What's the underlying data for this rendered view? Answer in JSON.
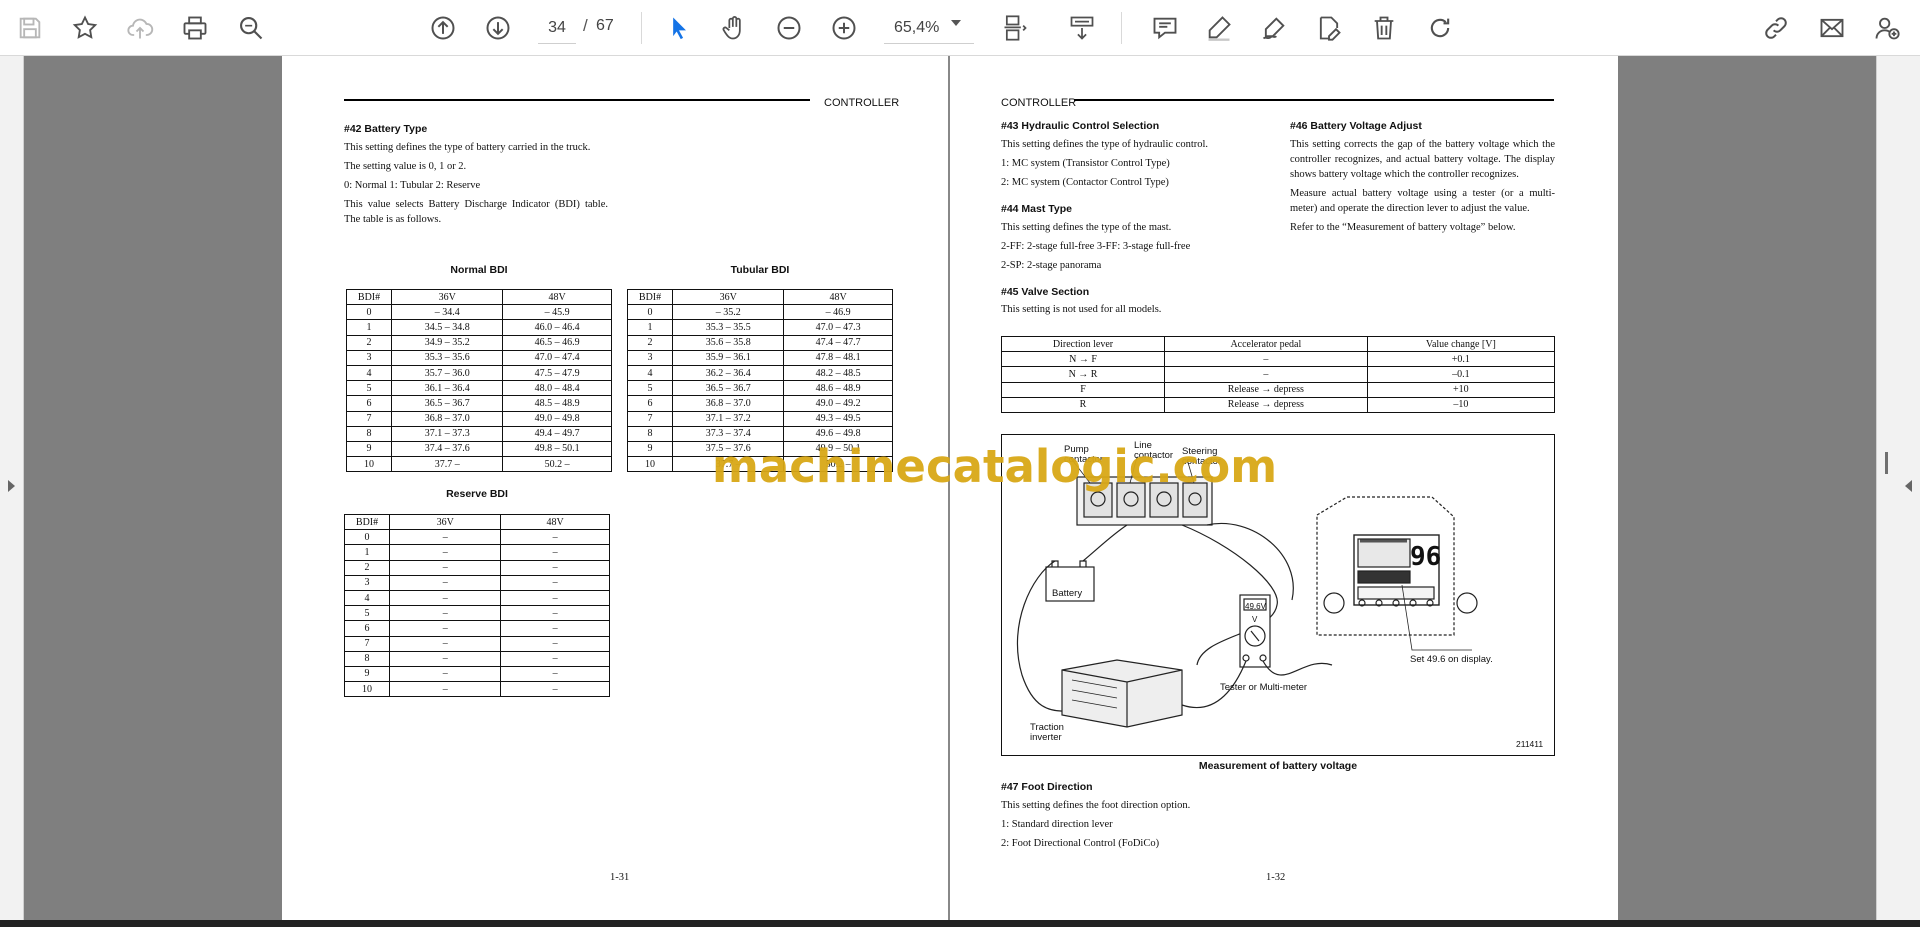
{
  "toolbar": {
    "current_page": "34",
    "page_separator": "/",
    "total_pages": "67",
    "zoom": "65,4%",
    "icons": [
      "save-icon",
      "bookmark-star-icon",
      "cloud-upload-icon",
      "print-icon",
      "find-text-icon",
      "page-up-icon",
      "page-down-icon",
      "select-cursor-icon",
      "hand-tool-icon",
      "zoom-out-icon",
      "zoom-in-icon",
      "page-fit-icon",
      "scroll-mode-icon",
      "comment-icon",
      "highlight-pen-icon",
      "draw-sign-icon",
      "fill-sign-icon",
      "delete-icon",
      "rotate-icon",
      "share-link-icon",
      "email-icon",
      "add-user-icon"
    ]
  },
  "colors": {
    "accent": "#1473e6",
    "watermark": "#d9a817",
    "viewer_bg": "#7f7f7f"
  },
  "watermark": "machinecatalogic.com",
  "left_page": {
    "header": "CONTROLLER",
    "section_title": "#42 Battery Type",
    "paragraphs": [
      "This setting defines the type of battery carried in the truck.",
      "The setting value is 0, 1 or 2.",
      "0: Normal  1: Tubular  2: Reserve",
      "This value selects Battery Discharge Indicator (BDI) table. The table is as follows."
    ],
    "normal_bdi": {
      "title": "Normal BDI",
      "headers": [
        "BDI#",
        "36V",
        "48V"
      ],
      "rows": [
        [
          "0",
          "– 34.4",
          "– 45.9"
        ],
        [
          "1",
          "34.5 – 34.8",
          "46.0 – 46.4"
        ],
        [
          "2",
          "34.9 – 35.2",
          "46.5 – 46.9"
        ],
        [
          "3",
          "35.3 – 35.6",
          "47.0 – 47.4"
        ],
        [
          "4",
          "35.7 – 36.0",
          "47.5 – 47.9"
        ],
        [
          "5",
          "36.1 – 36.4",
          "48.0 – 48.4"
        ],
        [
          "6",
          "36.5 – 36.7",
          "48.5 – 48.9"
        ],
        [
          "7",
          "36.8 – 37.0",
          "49.0 – 49.8"
        ],
        [
          "8",
          "37.1 – 37.3",
          "49.4 – 49.7"
        ],
        [
          "9",
          "37.4 – 37.6",
          "49.8 – 50.1"
        ],
        [
          "10",
          "37.7 –",
          "50.2 –"
        ]
      ]
    },
    "tubular_bdi": {
      "title": "Tubular BDI",
      "headers": [
        "BDI#",
        "36V",
        "48V"
      ],
      "rows": [
        [
          "0",
          "– 35.2",
          "– 46.9"
        ],
        [
          "1",
          "35.3 – 35.5",
          "47.0 – 47.3"
        ],
        [
          "2",
          "35.6 – 35.8",
          "47.4 – 47.7"
        ],
        [
          "3",
          "35.9 – 36.1",
          "47.8 – 48.1"
        ],
        [
          "4",
          "36.2 – 36.4",
          "48.2 – 48.5"
        ],
        [
          "5",
          "36.5 – 36.7",
          "48.6 – 48.9"
        ],
        [
          "6",
          "36.8 – 37.0",
          "49.0 – 49.2"
        ],
        [
          "7",
          "37.1 – 37.2",
          "49.3 – 49.5"
        ],
        [
          "8",
          "37.3 – 37.4",
          "49.6 – 49.8"
        ],
        [
          "9",
          "37.5 – 37.6",
          "49.9 – 50.1"
        ],
        [
          "10",
          "37.7 –",
          "50.2 –"
        ]
      ]
    },
    "reserve_bdi": {
      "title": "Reserve BDI",
      "headers": [
        "BDI#",
        "36V",
        "48V"
      ],
      "rows": [
        [
          "0",
          "–",
          "–"
        ],
        [
          "1",
          "–",
          "–"
        ],
        [
          "2",
          "–",
          "–"
        ],
        [
          "3",
          "–",
          "–"
        ],
        [
          "4",
          "–",
          "–"
        ],
        [
          "5",
          "–",
          "–"
        ],
        [
          "6",
          "–",
          "–"
        ],
        [
          "7",
          "–",
          "–"
        ],
        [
          "8",
          "–",
          "–"
        ],
        [
          "9",
          "–",
          "–"
        ],
        [
          "10",
          "–",
          "–"
        ]
      ]
    },
    "page_number": "1-31"
  },
  "right_page": {
    "header": "CONTROLLER",
    "s43": {
      "title": "#43 Hydraulic Control Selection",
      "paragraphs": [
        "This setting defines the type of hydraulic control.",
        "1: MC system (Transistor Control Type)",
        "2: MC system (Contactor Control Type)"
      ]
    },
    "s44": {
      "title": "#44 Mast Type",
      "paragraphs": [
        "This setting defines the type of the mast.",
        "2-FF: 2-stage full-free  3-FF: 3-stage full-free",
        "2-SP: 2-stage panorama"
      ]
    },
    "s45": {
      "title": "#45 Valve Section",
      "paragraphs": [
        "This setting is not used for all models."
      ]
    },
    "s46": {
      "title": "#46 Battery Voltage Adjust",
      "paragraphs": [
        "This setting corrects the gap of the battery voltage which the controller recognizes, and actual battery voltage. The display shows battery voltage which the controller recognizes.",
        "Measure actual battery voltage using a tester (or a multi-meter) and operate the direction lever to adjust the value.",
        "Refer to the “Measurement of battery voltage” below."
      ]
    },
    "value_table": {
      "headers": [
        "Direction lever",
        "Accelerator pedal",
        "Value change [V]"
      ],
      "rows": [
        [
          "N → F",
          "–",
          "+0.1"
        ],
        [
          "N → R",
          "–",
          "–0.1"
        ],
        [
          "F",
          "Release → depress",
          "+10"
        ],
        [
          "R",
          "Release → depress",
          "–10"
        ]
      ]
    },
    "figure": {
      "labels": {
        "pump": "Pump\ncontactor",
        "line": "Line\ncontactor",
        "steering": "Steering\ncontactor",
        "battery": "Battery",
        "meter_value": "49.6V",
        "meter_unit": "V",
        "tester": "Tester or Multi-meter",
        "display_note": "Set 49.6 on display.",
        "traction": "Traction\ninverter",
        "fig_id": "211411",
        "display_digits": "96"
      },
      "caption": "Measurement of battery voltage"
    },
    "s47": {
      "title": "#47 Foot Direction",
      "paragraphs": [
        "This setting defines the foot direction option.",
        "1: Standard direction lever",
        "2: Foot Directional Control (FoDiCo)"
      ]
    },
    "page_number": "1-32"
  }
}
